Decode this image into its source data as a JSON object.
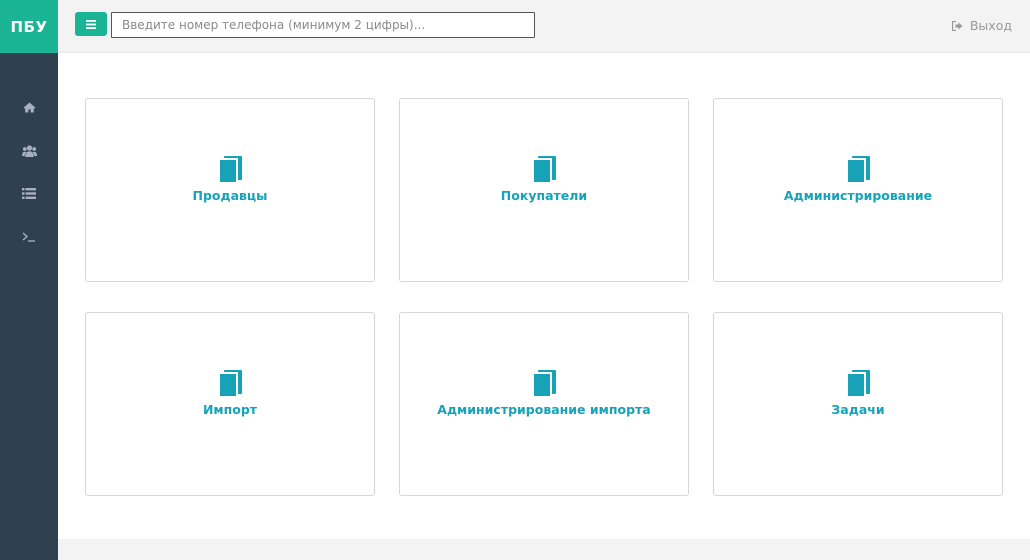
{
  "sidebar": {
    "brand": "ПБУ",
    "items": [
      {
        "icon": "home-icon"
      },
      {
        "icon": "users-icon"
      },
      {
        "icon": "list-icon"
      },
      {
        "icon": "terminal-icon"
      }
    ]
  },
  "header": {
    "menu_icon": "hamburger-icon",
    "search_placeholder": "Введите номер телефона (минимум 2 цифры)...",
    "search_value": "",
    "logout_label": "Выход",
    "logout_icon": "sign-out-icon"
  },
  "tiles": [
    {
      "label": "Продавцы",
      "icon": "book-icon"
    },
    {
      "label": "Покупатели",
      "icon": "book-icon"
    },
    {
      "label": "Администрирование",
      "icon": "book-icon"
    },
    {
      "label": "Импорт",
      "icon": "book-icon"
    },
    {
      "label": "Администрирование импорта",
      "icon": "book-icon"
    },
    {
      "label": "Задачи",
      "icon": "book-icon"
    }
  ],
  "colors": {
    "sidebar_bg": "#2f4050",
    "brand_bg": "#1ab394",
    "accent": "#1ab394",
    "tile_text": "#17a2b8",
    "book_icon": "#17a2b8"
  }
}
